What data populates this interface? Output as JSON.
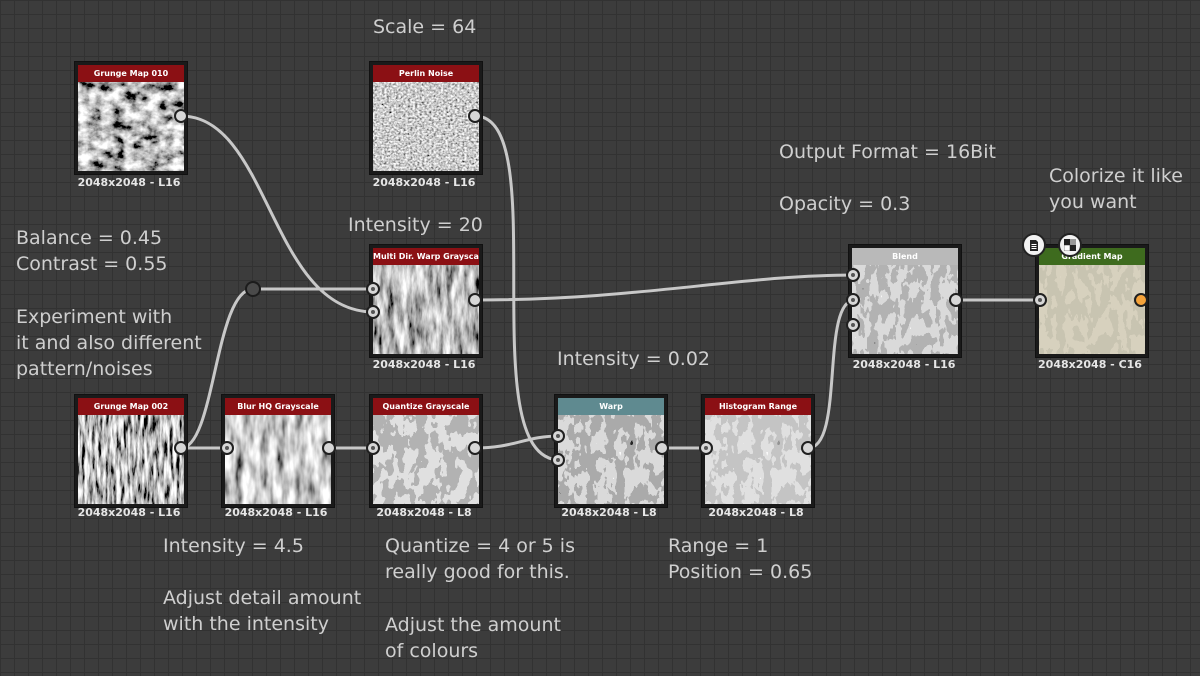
{
  "colors": {
    "header_red": "#8b1014",
    "header_gray": "#b9b9b9",
    "header_teal": "#5f8a90",
    "header_green": "#3e6b1e",
    "wire": "#c8c8c8",
    "port_output_gradient": "#f5a33b"
  },
  "nodes": {
    "grunge010": {
      "title": "Grunge Map 010",
      "resolution": "2048x2048 - L16"
    },
    "perlin": {
      "title": "Perlin Noise",
      "resolution": "2048x2048 - L16"
    },
    "multiwarp": {
      "title": "Multi Dir. Warp Grayscale",
      "resolution": "2048x2048 - L16"
    },
    "grunge002": {
      "title": "Grunge Map 002",
      "resolution": "2048x2048 - L16"
    },
    "blur": {
      "title": "Blur HQ Grayscale",
      "resolution": "2048x2048 - L16"
    },
    "quantize": {
      "title": "Quantize Grayscale",
      "resolution": "2048x2048 - L8"
    },
    "warp": {
      "title": "Warp",
      "resolution": "2048x2048 - L8"
    },
    "histogram": {
      "title": "Histogram Range",
      "resolution": "2048x2048 - L8"
    },
    "blend": {
      "title": "Blend",
      "resolution": "2048x2048 - L16"
    },
    "gradient": {
      "title": "Gradient Map",
      "resolution": "2048x2048 - C16"
    }
  },
  "notes": {
    "scale": "Scale = 64",
    "intensity20": "Intensity = 20",
    "balance": "Balance = 0.45\nContrast = 0.55",
    "experiment": "Experiment with\nit and also different\npattern/noises",
    "output_format": "Output Format = 16Bit",
    "opacity": "Opacity = 0.3",
    "colorize": "Colorize it like\nyou want",
    "intensity002": "Intensity = 0.02",
    "intensity45": "Intensity = 4.5",
    "adjust_detail": "Adjust detail amount\nwith the intensity",
    "quantize": "Quantize = 4 or 5 is\nreally good for this.",
    "adjust_amount": "Adjust the amount\nof colours",
    "range": "Range = 1\nPosition = 0.65"
  },
  "icons": {
    "gradient_badge_1": "document-icon",
    "gradient_badge_2": "checker-icon"
  }
}
